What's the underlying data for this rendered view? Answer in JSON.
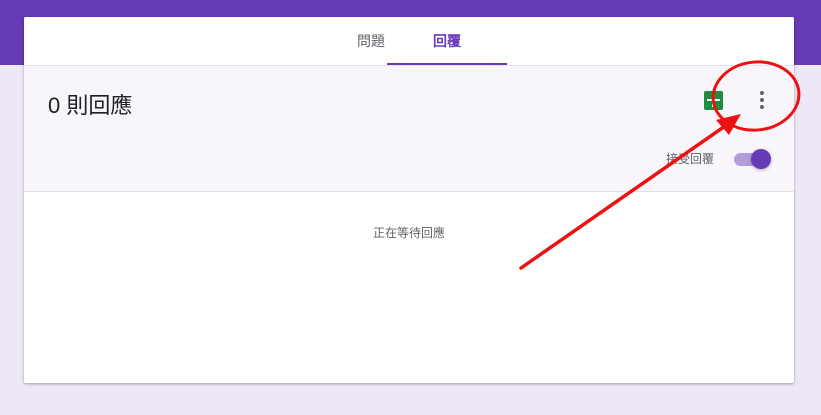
{
  "tabs": {
    "questions_label": "問題",
    "responses_label": "回覆"
  },
  "summary": {
    "count_text": "0 則回應"
  },
  "settings": {
    "accept_label": "接受回覆",
    "accepting": true
  },
  "main": {
    "waiting_text": "正在等待回應"
  },
  "icons": {
    "sheets": "google-sheets-icon",
    "more": "more-vert-icon"
  },
  "colors": {
    "brand": "#673ab7",
    "background": "#ede7f6",
    "sheets_green": "#1e8e3e",
    "annotation_red": "#ee1111"
  }
}
